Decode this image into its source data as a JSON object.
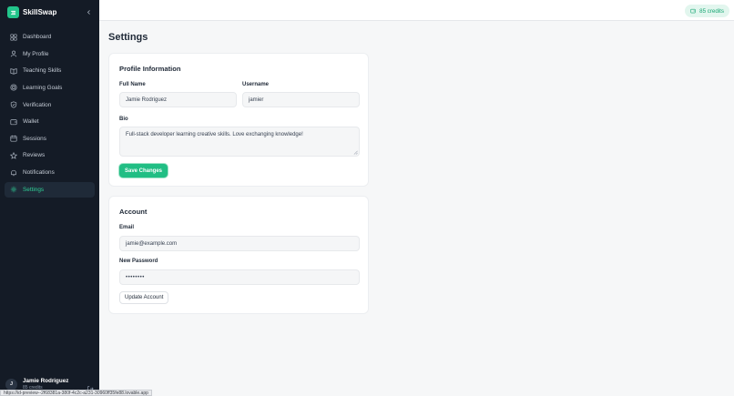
{
  "app": {
    "name": "SkillSwap"
  },
  "sidebar": {
    "items": [
      {
        "label": "Dashboard",
        "icon": "dashboard-icon"
      },
      {
        "label": "My Profile",
        "icon": "user-icon"
      },
      {
        "label": "Teaching Skills",
        "icon": "book-icon"
      },
      {
        "label": "Learning Goals",
        "icon": "target-icon"
      },
      {
        "label": "Verification",
        "icon": "shield-icon"
      },
      {
        "label": "Wallet",
        "icon": "wallet-icon"
      },
      {
        "label": "Sessions",
        "icon": "calendar-icon"
      },
      {
        "label": "Reviews",
        "icon": "star-icon"
      },
      {
        "label": "Notifications",
        "icon": "bell-icon"
      },
      {
        "label": "Settings",
        "icon": "gear-icon",
        "active": true
      }
    ]
  },
  "user": {
    "initial": "J",
    "name": "Jamie Rodriguez",
    "credits": "85 credits"
  },
  "header": {
    "credits": "85 credits"
  },
  "page": {
    "title": "Settings"
  },
  "profile": {
    "title": "Profile Information",
    "full_name_label": "Full Name",
    "full_name_value": "Jamie Rodriguez",
    "username_label": "Username",
    "username_value": "jamier",
    "bio_label": "Bio",
    "bio_value": "Full-stack developer learning creative skills. Love exchanging knowledge!",
    "save_label": "Save Changes"
  },
  "account": {
    "title": "Account",
    "email_label": "Email",
    "email_value": "jamie@example.com",
    "password_label": "New Password",
    "password_value": "••••••••",
    "update_label": "Update Account"
  },
  "status_url": "https://id-preview--2f68381a-380f-4c2c-a231-30960ff35fe88.lovable.app",
  "colors": {
    "accent": "#21be84",
    "sidebar_bg": "#141b26",
    "active_text": "#2fcf96"
  }
}
